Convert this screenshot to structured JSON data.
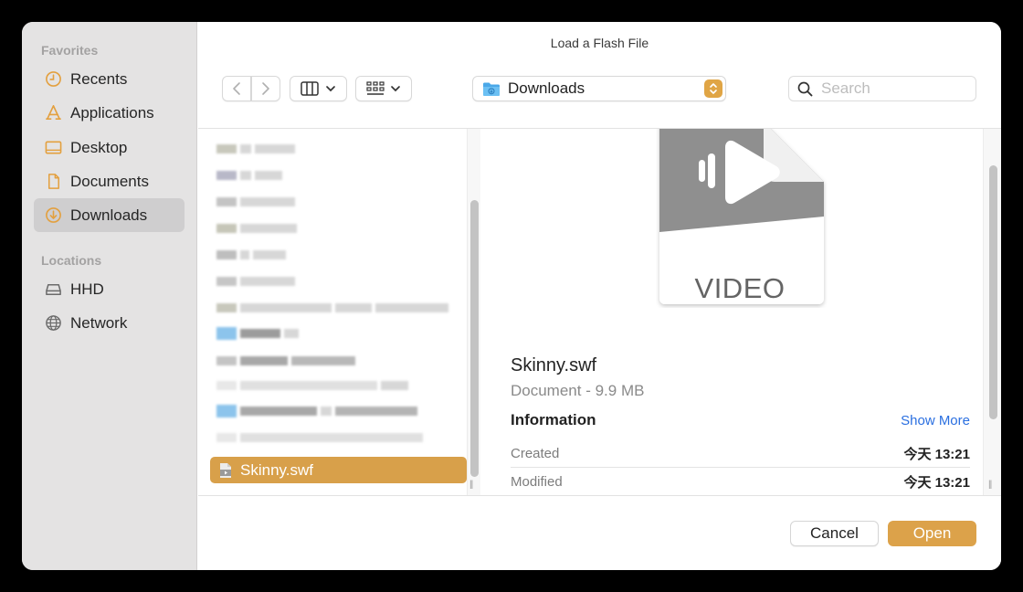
{
  "dialog": {
    "title": "Load a Flash File"
  },
  "sidebar": {
    "favorites_label": "Favorites",
    "favorites": [
      {
        "label": "Recents",
        "icon": "clock-icon"
      },
      {
        "label": "Applications",
        "icon": "applications-icon"
      },
      {
        "label": "Desktop",
        "icon": "desktop-icon"
      },
      {
        "label": "Documents",
        "icon": "document-icon"
      },
      {
        "label": "Downloads",
        "icon": "download-icon",
        "selected": true
      }
    ],
    "locations_label": "Locations",
    "locations": [
      {
        "label": "HHD",
        "icon": "hard-drive-icon"
      },
      {
        "label": "Network",
        "icon": "globe-icon"
      }
    ]
  },
  "toolbar": {
    "location": "Downloads",
    "search_placeholder": "Search"
  },
  "file_list": {
    "selected_file": "Skinny.swf"
  },
  "preview": {
    "icon_label": "VIDEO",
    "file_name": "Skinny.swf",
    "subtitle": "Document - 9.9 MB",
    "info_heading": "Information",
    "show_more": "Show More",
    "rows": [
      {
        "key": "Created",
        "value": "今天 13:21"
      },
      {
        "key": "Modified",
        "value": "今天 13:21"
      }
    ]
  },
  "buttons": {
    "cancel": "Cancel",
    "open": "Open"
  },
  "colors": {
    "accent": "#dca24a",
    "link": "#2a6fe0",
    "sidebar_bg": "#e4e3e3",
    "selected_sidebar": "#cfcecf"
  }
}
